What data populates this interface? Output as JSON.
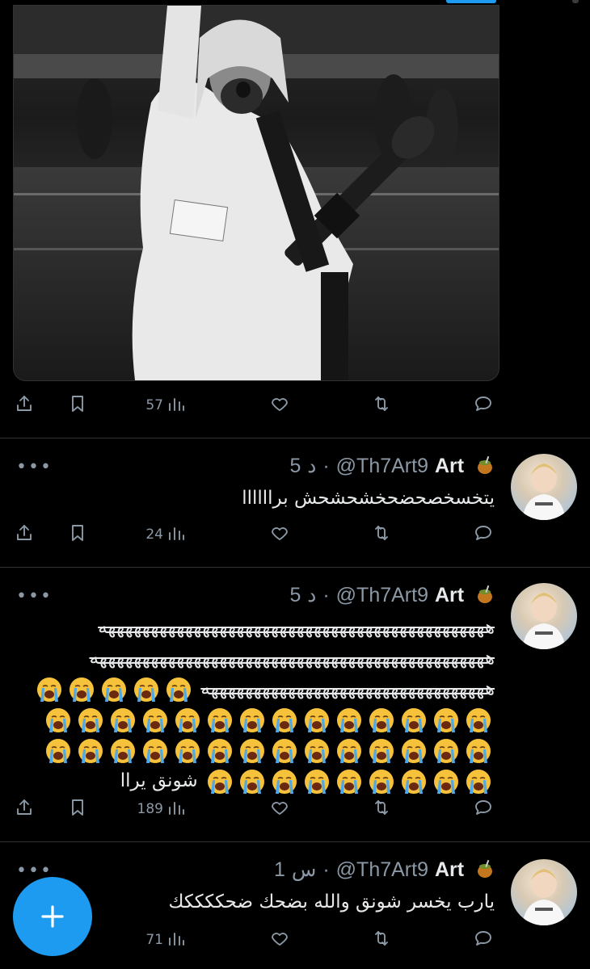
{
  "post": {
    "image_alt": "",
    "views": "57"
  },
  "replies": [
    {
      "name": "Art",
      "handle": "@Th7Art9",
      "separator": "·",
      "time_num": "5",
      "time_unit": "د",
      "text": "يتخسخصحضحخشحشحش براااااا",
      "views": "24"
    },
    {
      "name": "Art",
      "handle": "@Th7Art9",
      "separator": "·",
      "time_num": "5",
      "time_unit": "د",
      "line1": "هههههههههههههههههههههههههههههههههههههههههههههه",
      "line2": "ههههههههههههههههههههههههههههههههههههههههههههههه",
      "line3": "هههههههههههههههههههههههههههههههههه",
      "tail": "شونق يراا",
      "views": "189"
    },
    {
      "name": "Art",
      "handle": "@Th7Art9",
      "separator": "·",
      "time_num": "1",
      "time_unit": "س",
      "text": "يارب يخسر شونق والله بضحك ضحككككك",
      "views": "71"
    }
  ],
  "icons": {
    "share": "share-icon",
    "bookmark": "bookmark-icon",
    "views": "views-icon",
    "like": "heart-icon",
    "retweet": "retweet-icon",
    "reply": "reply-icon",
    "compose": "plus-icon"
  },
  "colors": {
    "accent": "#1d9bf0",
    "muted": "#8b98a5",
    "text": "#e7e9ea",
    "background": "#000000"
  }
}
